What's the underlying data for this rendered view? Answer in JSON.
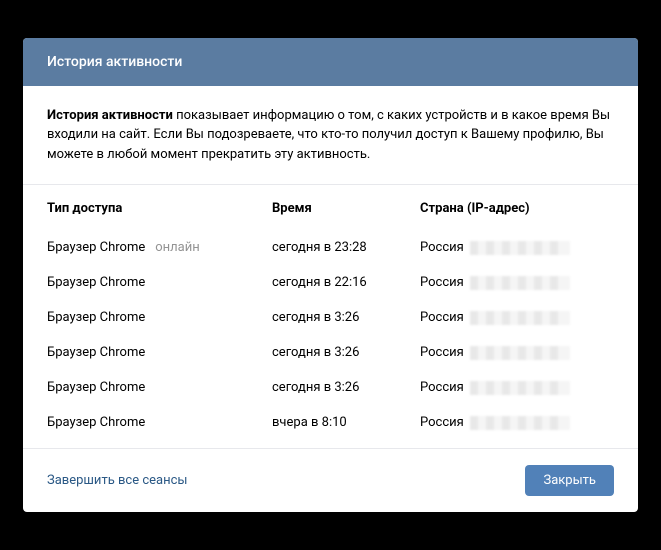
{
  "header": {
    "title": "История активности"
  },
  "description": {
    "bold": "История активности",
    "text": " показывает информацию о том, с каких устройств и в какое время Вы входили на сайт. Если Вы подозреваете, что кто-то получил доступ к Вашему профилю, Вы можете в любой момент прекратить эту активность."
  },
  "table": {
    "headers": {
      "access": "Тип доступа",
      "time": "Время",
      "country": "Страна (IP-адрес)"
    },
    "online_label": "онлайн",
    "rows": [
      {
        "access": "Браузер Chrome",
        "online": true,
        "time": "сегодня в 23:28",
        "country": "Россия"
      },
      {
        "access": "Браузер Chrome",
        "online": false,
        "time": "сегодня в 22:16",
        "country": "Россия"
      },
      {
        "access": "Браузер Chrome",
        "online": false,
        "time": "сегодня в 3:26",
        "country": "Россия"
      },
      {
        "access": "Браузер Chrome",
        "online": false,
        "time": "сегодня в 3:26",
        "country": "Россия"
      },
      {
        "access": "Браузер Chrome",
        "online": false,
        "time": "сегодня в 3:26",
        "country": "Россия"
      },
      {
        "access": "Браузер Chrome",
        "online": false,
        "time": "вчера в 8:10",
        "country": "Россия"
      }
    ]
  },
  "footer": {
    "end_sessions": "Завершить все сеансы",
    "close": "Закрыть"
  }
}
